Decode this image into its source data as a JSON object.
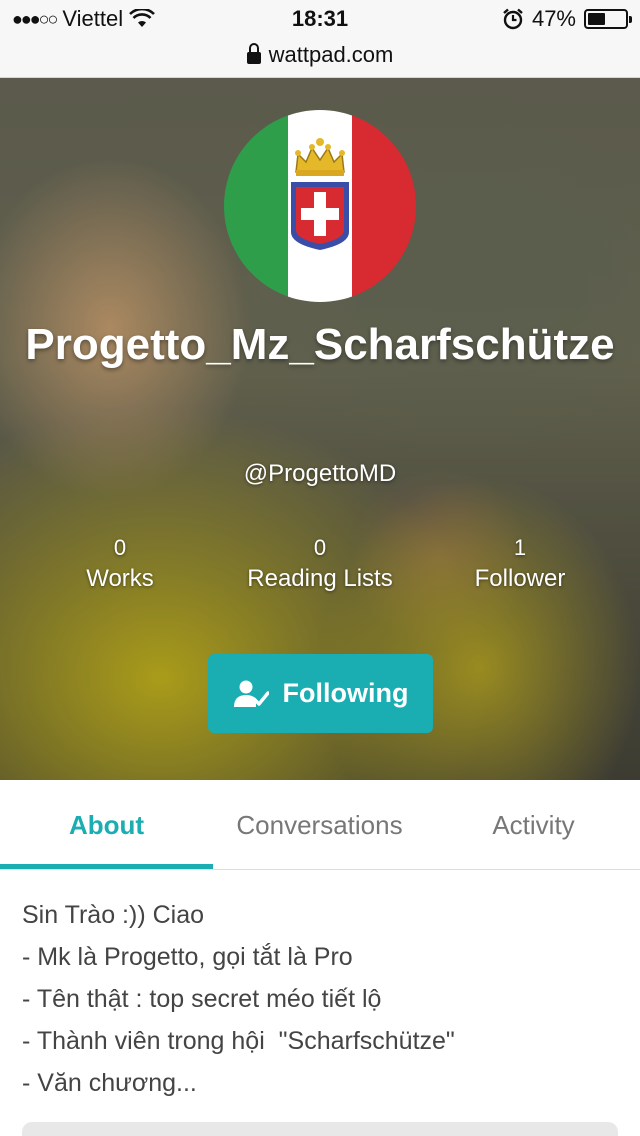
{
  "status_bar": {
    "signal": "●●●○○",
    "carrier": "Viettel",
    "time": "18:31",
    "battery_percent_text": "47%",
    "battery_level": 0.47
  },
  "url_bar": {
    "domain": "wattpad.com"
  },
  "profile": {
    "display_name": "Progetto_Mz_Scharfschütze",
    "handle": "@ProgettoMD",
    "stats": [
      {
        "value": "0",
        "label": "Works"
      },
      {
        "value": "0",
        "label": "Reading Lists"
      },
      {
        "value": "1",
        "label": "Follower"
      }
    ],
    "follow_button_label": "Following",
    "avatar_colors": {
      "green": "#2e9e4b",
      "white": "#ffffff",
      "red": "#d72b31"
    }
  },
  "tabs": [
    {
      "label": "About",
      "active": true
    },
    {
      "label": "Conversations",
      "active": false
    },
    {
      "label": "Activity",
      "active": false
    }
  ],
  "about": {
    "lines": [
      "Sin Trào :)) Ciao",
      "- Mk là Progetto, gọi tắt là Pro",
      "- Tên thật : top secret méo tiết lộ",
      "- Thành viên trong hội  \"Scharfschütze\"",
      "- Văn chương..."
    ]
  },
  "colors": {
    "accent": "#1aadb2"
  }
}
